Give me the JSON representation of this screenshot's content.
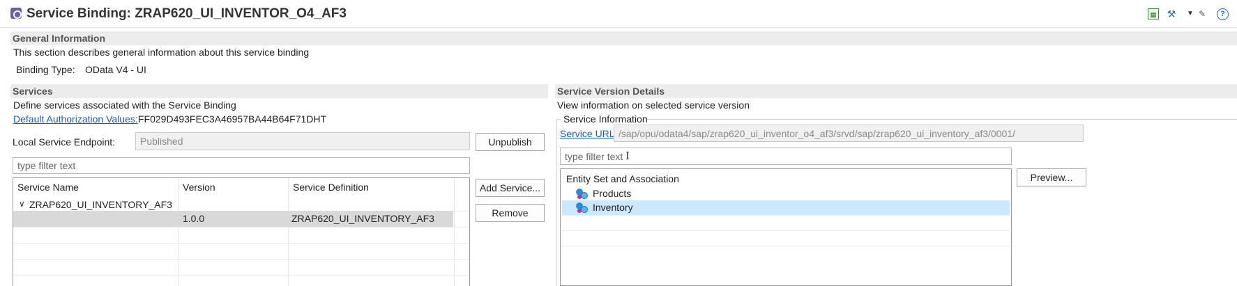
{
  "header": {
    "title": "Service Binding: ZRAP620_UI_INVENTOR_O4_AF3",
    "icons": [
      "service-binding-icon",
      "sheet-icon",
      "tools-icon",
      "dropdown-icon",
      "pencil-icon",
      "help-icon"
    ],
    "help_glyph": "?"
  },
  "general": {
    "heading": "General Information",
    "description": "This section describes general information about this service binding",
    "binding_type_label": "Binding Type:",
    "binding_type_value": "OData V4 - UI"
  },
  "services": {
    "heading": "Services",
    "description": "Define services associated with the Service Binding",
    "auth_link": "Default Authorization Values:",
    "auth_value": "FF029D493FEC3A46957BA44B64F71DHT",
    "endpoint_label": "Local Service Endpoint:",
    "endpoint_value": "Published",
    "unpublish_button": "Unpublish",
    "filter_placeholder": "type filter text",
    "add_service_button": "Add Service...",
    "remove_button": "Remove",
    "table": {
      "columns": [
        "Service Name",
        "Version",
        "Service Definition"
      ],
      "group_name": "ZRAP620_UI_INVENTORY_AF3",
      "rows": [
        {
          "version": "1.0.0",
          "definition": "ZRAP620_UI_INVENTORY_AF3"
        }
      ]
    }
  },
  "version_details": {
    "heading": "Service Version Details",
    "description": "View information on selected service version",
    "group_title": "Service Information",
    "url_link": "Service URL:",
    "url_value": "/sap/opu/odata4/sap/zrap620_ui_inventor_o4_af3/srvd/sap/zrap620_ui_inventory_af3/0001/",
    "filter_placeholder": "type filter text",
    "preview_button": "Preview...",
    "tree": {
      "header": "Entity Set and Association",
      "items": [
        {
          "label": "Products",
          "selected": false
        },
        {
          "label": "Inventory",
          "selected": true
        }
      ]
    }
  },
  "colors": {
    "section_header_bg": "#ececec",
    "link": "#1a5fb4",
    "selected_row": "#d9d9d9",
    "selected_tree_item": "#cce8ff"
  }
}
